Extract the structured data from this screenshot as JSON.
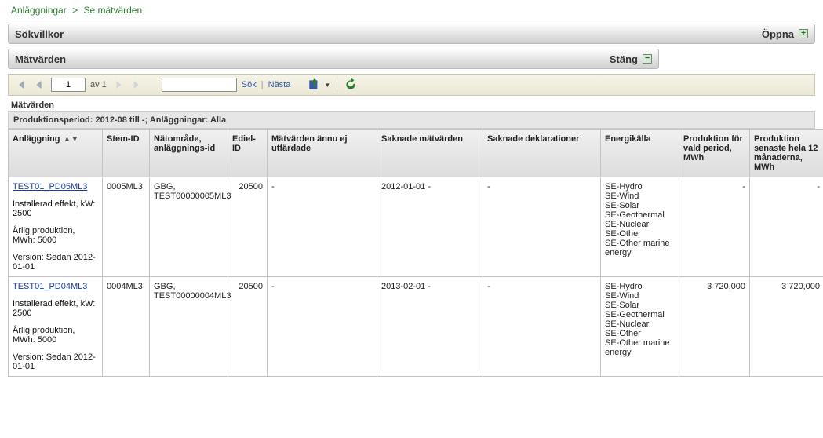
{
  "breadcrumb": {
    "root": "Anläggningar",
    "current": "Se mätvärden"
  },
  "panels": {
    "sokvillkor": {
      "title": "Sökvillkor",
      "action": "Öppna",
      "symbol": "+"
    },
    "matvarden": {
      "title": "Mätvärden",
      "action": "Stäng",
      "symbol": "−"
    }
  },
  "toolbar": {
    "page_input": "1",
    "of_label": "av 1",
    "search_input": "",
    "search_label": "Sök",
    "next_label": "Nästa"
  },
  "section_label": "Mätvärden",
  "subline": "Produktionsperiod: 2012-08 till -; Anläggningar: Alla",
  "cols": {
    "anl": "Anläggning",
    "stem": "Stem-ID",
    "nat": "Nätområde, anläggnings-id",
    "edi": "Ediel-ID",
    "mnu": "Mätvärden ännu ej utfärdade",
    "sakm": "Saknade mätvärden",
    "sakd": "Saknade deklarationer",
    "ene": "Energikälla",
    "p1": "Produktion för vald period, MWh",
    "p2": "Produktion senaste hela 12 månaderna, MWh"
  },
  "rows": [
    {
      "anl_link": "TEST01_PD05ML3",
      "anl_lines": [
        "Installerad effekt, kW: 2500",
        "Årlig produktion, MWh: 5000",
        "Version: Sedan 2012-01-01"
      ],
      "stem": "0005ML3",
      "nat": "GBG, TEST00000005ML3",
      "edi": "20500",
      "mnu": "-",
      "sakm": "2012-01-01 -",
      "sakd": "-",
      "ene": "SE-Hydro\nSE-Wind\nSE-Solar\nSE-Geothermal\nSE-Nuclear\nSE-Other\nSE-Other marine energy",
      "p1": "-",
      "p2": "-"
    },
    {
      "anl_link": "TEST01_PD04ML3",
      "anl_lines": [
        "Installerad effekt, kW: 2500",
        "Årlig produktion, MWh: 5000",
        "Version: Sedan 2012-01-01"
      ],
      "stem": "0004ML3",
      "nat": "GBG, TEST00000004ML3",
      "edi": "20500",
      "mnu": "-",
      "sakm": "2013-02-01 -",
      "sakd": "-",
      "ene": "SE-Hydro\nSE-Wind\nSE-Solar\nSE-Geothermal\nSE-Nuclear\nSE-Other\nSE-Other marine energy",
      "p1": "3 720,000",
      "p2": "3 720,000"
    }
  ]
}
